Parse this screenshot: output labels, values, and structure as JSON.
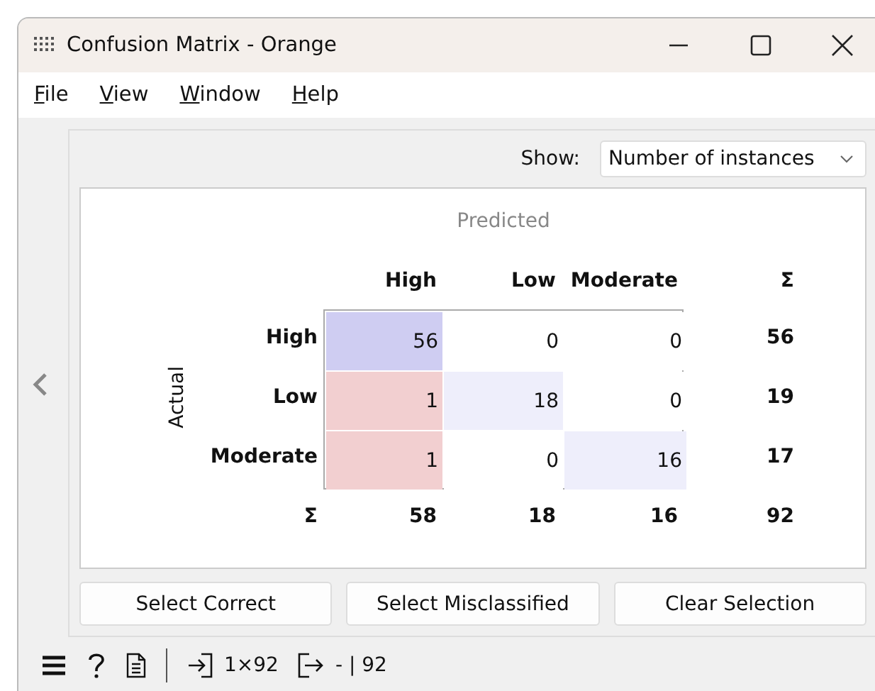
{
  "window": {
    "title": "Confusion Matrix - Orange"
  },
  "menu": [
    {
      "label": "File"
    },
    {
      "label": "View"
    },
    {
      "label": "Window"
    },
    {
      "label": "Help"
    }
  ],
  "show": {
    "label": "Show:",
    "value": "Number of instances"
  },
  "matrix": {
    "predicted_label": "Predicted",
    "actual_label": "Actual",
    "columns": [
      "High",
      "Low",
      "Moderate"
    ],
    "total_header": "Σ",
    "rows": [
      {
        "label": "High",
        "cells": [
          {
            "value": "56",
            "color": "#cfcdf2"
          },
          {
            "value": "0",
            "color": "#ffffff"
          },
          {
            "value": "0",
            "color": "#ffffff"
          }
        ],
        "total": "56"
      },
      {
        "label": "Low",
        "cells": [
          {
            "value": "1",
            "color": "#f2cfd0"
          },
          {
            "value": "18",
            "color": "#eeeefb"
          },
          {
            "value": "0",
            "color": "#ffffff"
          }
        ],
        "total": "19"
      },
      {
        "label": "Moderate",
        "cells": [
          {
            "value": "1",
            "color": "#f2cfd0"
          },
          {
            "value": "0",
            "color": "#ffffff"
          },
          {
            "value": "16",
            "color": "#eeeefb"
          }
        ],
        "total": "17"
      }
    ],
    "totals": {
      "label": "Σ",
      "values": [
        "58",
        "18",
        "16"
      ],
      "grand_total": "92"
    }
  },
  "buttons": [
    "Select Correct",
    "Select Misclassified",
    "Clear Selection"
  ],
  "status_bar": {
    "input": "1×92",
    "output": "- | 92"
  }
}
